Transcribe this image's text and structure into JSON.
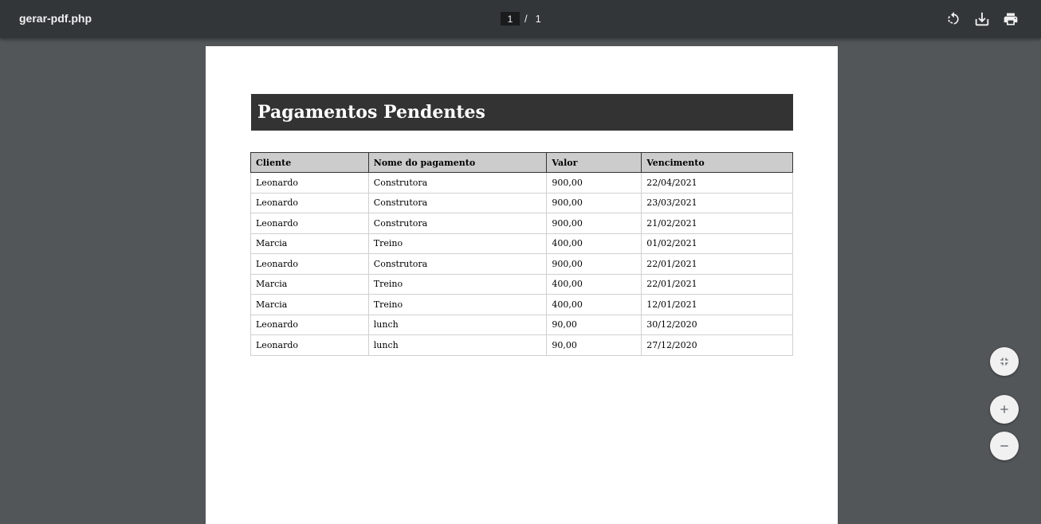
{
  "viewer": {
    "title": "gerar-pdf.php",
    "current_page": "1",
    "page_separator": "/",
    "total_pages": "1"
  },
  "icons": {
    "rotate": "rotate-icon",
    "download": "download-icon",
    "print": "print-icon",
    "fit": "fit-to-page-icon",
    "zoom_in": "zoom-in-icon",
    "zoom_out": "zoom-out-icon"
  },
  "colors": {
    "toolbar": "#323639",
    "viewer_bg": "#525659",
    "title_bar": "#333333",
    "header_bg": "#cccccc"
  },
  "document": {
    "heading": "Pagamentos Pendentes",
    "columns": [
      "Cliente",
      "Nome do pagamento",
      "Valor",
      "Vencimento"
    ],
    "rows": [
      [
        "Leonardo",
        "Construtora",
        "900,00",
        "22/04/2021"
      ],
      [
        "Leonardo",
        "Construtora",
        "900,00",
        "23/03/2021"
      ],
      [
        "Leonardo",
        "Construtora",
        "900,00",
        "21/02/2021"
      ],
      [
        "Marcia",
        "Treino",
        "400,00",
        "01/02/2021"
      ],
      [
        "Leonardo",
        "Construtora",
        "900,00",
        "22/01/2021"
      ],
      [
        "Marcia",
        "Treino",
        "400,00",
        "22/01/2021"
      ],
      [
        "Marcia",
        "Treino",
        "400,00",
        "12/01/2021"
      ],
      [
        "Leonardo",
        "lunch",
        "90,00",
        "30/12/2020"
      ],
      [
        "Leonardo",
        "lunch",
        "90,00",
        "27/12/2020"
      ]
    ]
  }
}
